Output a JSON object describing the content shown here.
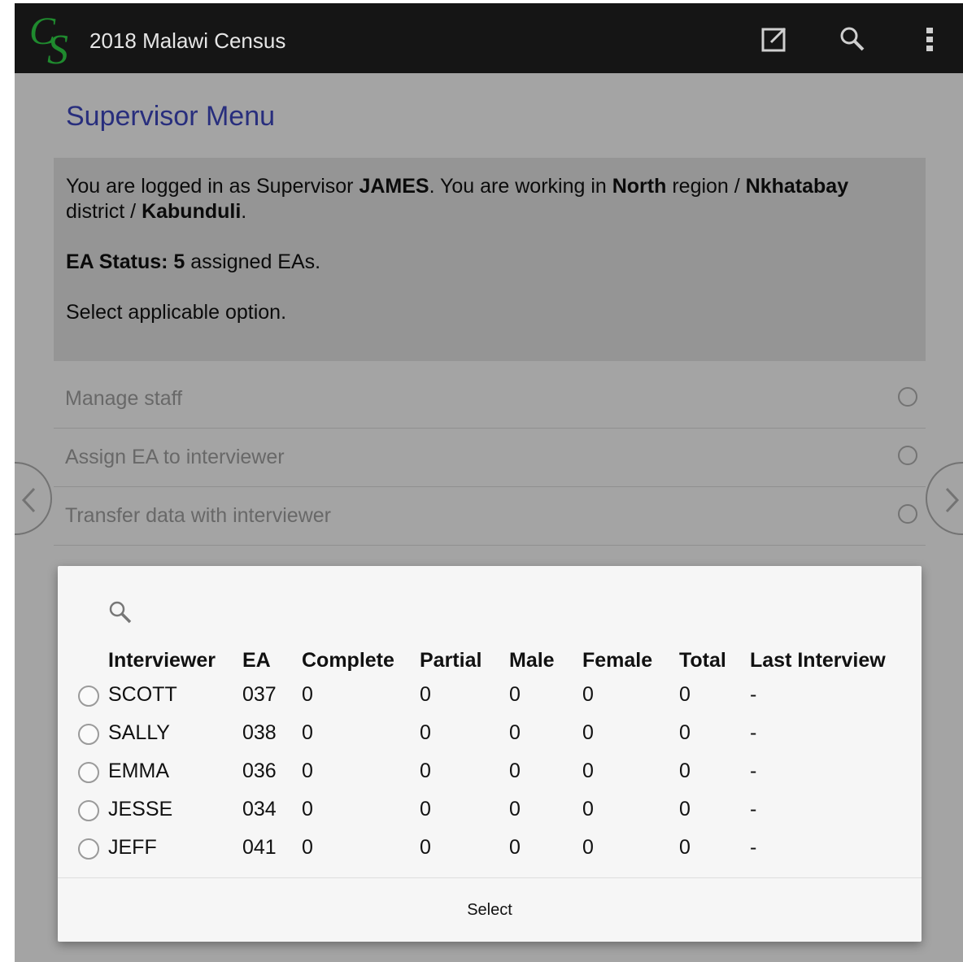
{
  "app": {
    "title": "2018 Malawi Census"
  },
  "toolbar": {
    "icons": [
      "edit-icon",
      "search-icon",
      "more-vert-icon"
    ]
  },
  "page": {
    "title": "Supervisor Menu"
  },
  "info": {
    "line1_a": "You are logged in as Supervisor ",
    "supervisor": "JAMES",
    "line1_b": ". You are working in ",
    "region": "North",
    "line1_c": " region / ",
    "district": "Nkhatabay",
    "line1_d": " district / ",
    "area": "Kabunduli",
    "line1_e": ".",
    "status_label": "EA Status: ",
    "status_count": "5",
    "status_suffix": " assigned EAs.",
    "instruction": "Select applicable option."
  },
  "options": [
    {
      "label": "Manage staff"
    },
    {
      "label": "Assign EA to interviewer"
    },
    {
      "label": "Transfer data with interviewer"
    }
  ],
  "dialog": {
    "columns": [
      "Interviewer",
      "EA",
      "Complete",
      "Partial",
      "Male",
      "Female",
      "Total",
      "Last Interview"
    ],
    "rows": [
      {
        "name": "SCOTT",
        "ea": "037",
        "complete": "0",
        "partial": "0",
        "male": "0",
        "female": "0",
        "total": "0",
        "last": "-"
      },
      {
        "name": "SALLY",
        "ea": "038",
        "complete": "0",
        "partial": "0",
        "male": "0",
        "female": "0",
        "total": "0",
        "last": "-"
      },
      {
        "name": "EMMA",
        "ea": "036",
        "complete": "0",
        "partial": "0",
        "male": "0",
        "female": "0",
        "total": "0",
        "last": "-"
      },
      {
        "name": "JESSE",
        "ea": "034",
        "complete": "0",
        "partial": "0",
        "male": "0",
        "female": "0",
        "total": "0",
        "last": "-"
      },
      {
        "name": "JEFF",
        "ea": "041",
        "complete": "0",
        "partial": "0",
        "male": "0",
        "female": "0",
        "total": "0",
        "last": "-"
      }
    ],
    "select_label": "Select"
  },
  "colors": {
    "topbar": "#151515",
    "title_accent": "#3b45b8",
    "logo_green": "#1f8a2e"
  }
}
